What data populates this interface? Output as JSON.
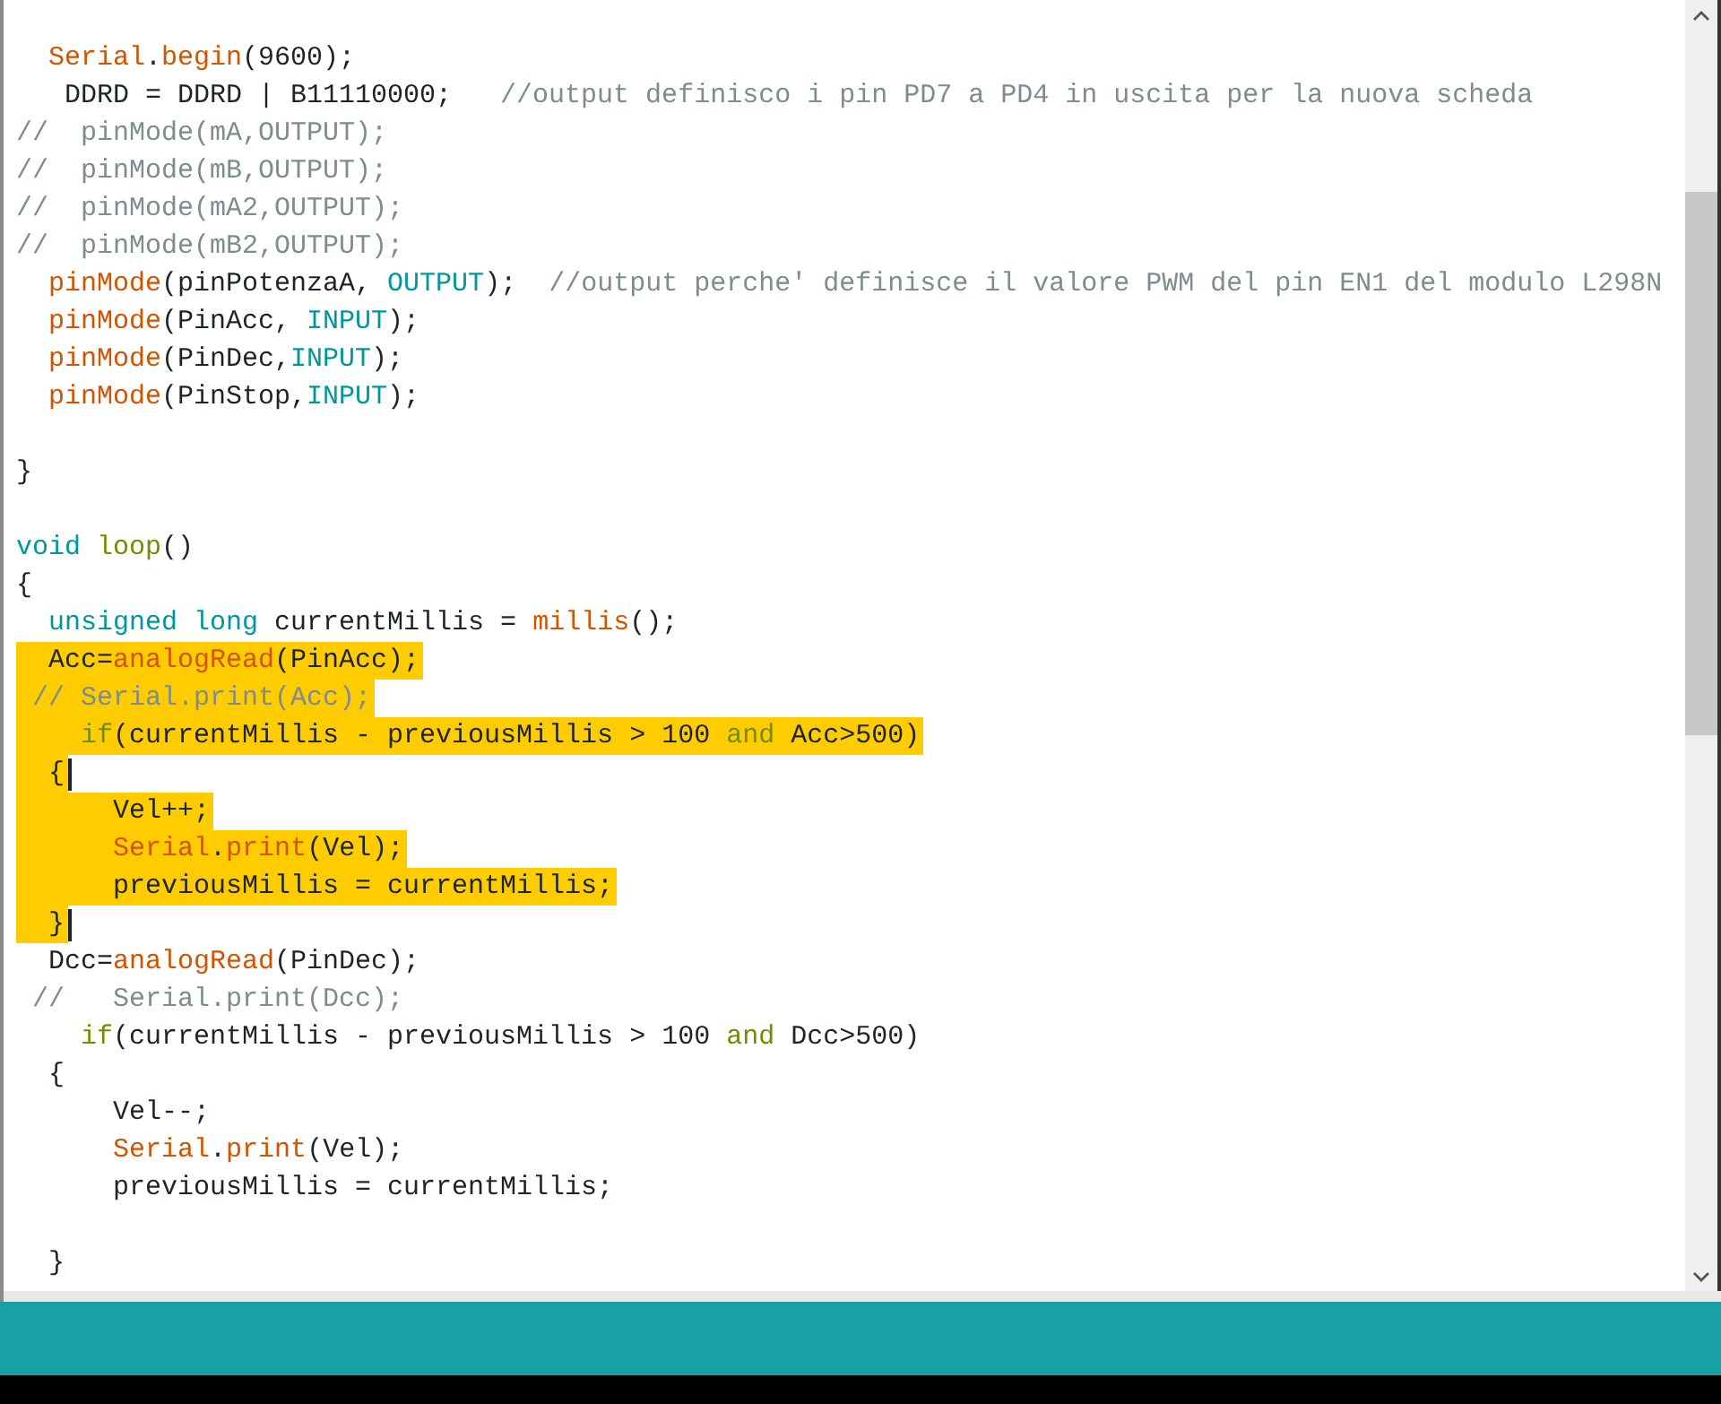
{
  "editor": {
    "lines": [
      {
        "highlighted": false,
        "caret": false,
        "segments": [
          {
            "text": "  Serial",
            "kind": "function"
          },
          {
            "text": ".",
            "kind": "plain"
          },
          {
            "text": "begin",
            "kind": "function"
          },
          {
            "text": "(9600);",
            "kind": "plain"
          }
        ]
      },
      {
        "highlighted": false,
        "caret": false,
        "segments": [
          {
            "text": "   DDRD = DDRD | B11110000;   ",
            "kind": "plain"
          },
          {
            "text": "//output definisco i pin PD7 a PD4 in uscita per la nuova scheda",
            "kind": "comment"
          }
        ]
      },
      {
        "highlighted": false,
        "caret": false,
        "segments": [
          {
            "text": "//  pinMode(mA,OUTPUT);",
            "kind": "comment"
          }
        ]
      },
      {
        "highlighted": false,
        "caret": false,
        "segments": [
          {
            "text": "//  pinMode(mB,OUTPUT);",
            "kind": "comment"
          }
        ]
      },
      {
        "highlighted": false,
        "caret": false,
        "segments": [
          {
            "text": "//  pinMode(mA2,OUTPUT);",
            "kind": "comment"
          }
        ]
      },
      {
        "highlighted": false,
        "caret": false,
        "segments": [
          {
            "text": "//  pinMode(mB2,OUTPUT);",
            "kind": "comment"
          }
        ]
      },
      {
        "highlighted": false,
        "caret": false,
        "segments": [
          {
            "text": "  pinMode",
            "kind": "function"
          },
          {
            "text": "(pinPotenzaA, ",
            "kind": "plain"
          },
          {
            "text": "OUTPUT",
            "kind": "constant"
          },
          {
            "text": ");  ",
            "kind": "plain"
          },
          {
            "text": "//output perche' definisce il valore PWM del pin EN1 del modulo L298N",
            "kind": "comment"
          }
        ]
      },
      {
        "highlighted": false,
        "caret": false,
        "segments": [
          {
            "text": "  pinMode",
            "kind": "function"
          },
          {
            "text": "(PinAcc, ",
            "kind": "plain"
          },
          {
            "text": "INPUT",
            "kind": "constant"
          },
          {
            "text": ");",
            "kind": "plain"
          }
        ]
      },
      {
        "highlighted": false,
        "caret": false,
        "segments": [
          {
            "text": "  pinMode",
            "kind": "function"
          },
          {
            "text": "(PinDec,",
            "kind": "plain"
          },
          {
            "text": "INPUT",
            "kind": "constant"
          },
          {
            "text": ");",
            "kind": "plain"
          }
        ]
      },
      {
        "highlighted": false,
        "caret": false,
        "segments": [
          {
            "text": "  pinMode",
            "kind": "function"
          },
          {
            "text": "(PinStop,",
            "kind": "plain"
          },
          {
            "text": "INPUT",
            "kind": "constant"
          },
          {
            "text": ");",
            "kind": "plain"
          }
        ]
      },
      {
        "highlighted": false,
        "caret": false
      },
      {
        "highlighted": false,
        "caret": false,
        "segments": [
          {
            "text": "}",
            "kind": "plain"
          }
        ]
      },
      {
        "highlighted": false,
        "caret": false
      },
      {
        "highlighted": false,
        "caret": false,
        "segments": [
          {
            "text": "void ",
            "kind": "keyword"
          },
          {
            "text": "loop",
            "kind": "control"
          },
          {
            "text": "()",
            "kind": "plain"
          }
        ]
      },
      {
        "highlighted": false,
        "caret": false,
        "segments": [
          {
            "text": "{",
            "kind": "plain"
          }
        ]
      },
      {
        "highlighted": false,
        "caret": false,
        "segments": [
          {
            "text": "  unsigned long",
            "kind": "keyword"
          },
          {
            "text": " currentMillis = ",
            "kind": "plain"
          },
          {
            "text": "millis",
            "kind": "function"
          },
          {
            "text": "();",
            "kind": "plain"
          }
        ]
      },
      {
        "highlighted": true,
        "caret": false,
        "segments": [
          {
            "text": "  Acc=",
            "kind": "plain"
          },
          {
            "text": "analogRead",
            "kind": "function"
          },
          {
            "text": "(PinAcc);",
            "kind": "plain"
          }
        ]
      },
      {
        "highlighted": true,
        "caret": false,
        "segments": [
          {
            "text": " // Serial.print(Acc);",
            "kind": "comment"
          }
        ]
      },
      {
        "highlighted": true,
        "caret": false,
        "segments": [
          {
            "text": "    if",
            "kind": "control"
          },
          {
            "text": "(currentMillis - previousMillis > 100 ",
            "kind": "plain"
          },
          {
            "text": "and",
            "kind": "control"
          },
          {
            "text": " Acc>500)",
            "kind": "plain"
          }
        ]
      },
      {
        "highlighted": true,
        "caret": true,
        "segments": [
          {
            "text": "  {",
            "kind": "plain"
          }
        ]
      },
      {
        "highlighted": true,
        "caret": false,
        "segments": [
          {
            "text": "      Vel++;",
            "kind": "plain"
          }
        ]
      },
      {
        "highlighted": true,
        "caret": false,
        "segments": [
          {
            "text": "      Serial",
            "kind": "function"
          },
          {
            "text": ".",
            "kind": "plain"
          },
          {
            "text": "print",
            "kind": "function"
          },
          {
            "text": "(Vel);",
            "kind": "plain"
          }
        ]
      },
      {
        "highlighted": true,
        "caret": false,
        "segments": [
          {
            "text": "      previousMillis = currentMillis;",
            "kind": "plain"
          }
        ]
      },
      {
        "highlighted": true,
        "caret": true,
        "segments": [
          {
            "text": "  }",
            "kind": "plain"
          }
        ]
      },
      {
        "highlighted": false,
        "caret": false,
        "segments": [
          {
            "text": "  Dcc=",
            "kind": "plain"
          },
          {
            "text": "analogRead",
            "kind": "function"
          },
          {
            "text": "(PinDec);",
            "kind": "plain"
          }
        ]
      },
      {
        "highlighted": false,
        "caret": false,
        "segments": [
          {
            "text": " //   Serial.print(Dcc);",
            "kind": "comment"
          }
        ]
      },
      {
        "highlighted": false,
        "caret": false,
        "segments": [
          {
            "text": "    if",
            "kind": "control"
          },
          {
            "text": "(currentMillis - previousMillis > 100 ",
            "kind": "plain"
          },
          {
            "text": "and",
            "kind": "control"
          },
          {
            "text": " Dcc>500)",
            "kind": "plain"
          }
        ]
      },
      {
        "highlighted": false,
        "caret": false,
        "segments": [
          {
            "text": "  {",
            "kind": "plain"
          }
        ]
      },
      {
        "highlighted": false,
        "caret": false,
        "segments": [
          {
            "text": "      Vel--;",
            "kind": "plain"
          }
        ]
      },
      {
        "highlighted": false,
        "caret": false,
        "segments": [
          {
            "text": "      Serial",
            "kind": "function"
          },
          {
            "text": ".",
            "kind": "plain"
          },
          {
            "text": "print",
            "kind": "function"
          },
          {
            "text": "(Vel);",
            "kind": "plain"
          }
        ]
      },
      {
        "highlighted": false,
        "caret": false,
        "segments": [
          {
            "text": "      previousMillis = currentMillis;",
            "kind": "plain"
          }
        ]
      },
      {
        "highlighted": false,
        "caret": false
      },
      {
        "highlighted": false,
        "caret": false,
        "segments": [
          {
            "text": "  }",
            "kind": "plain"
          }
        ]
      }
    ]
  }
}
